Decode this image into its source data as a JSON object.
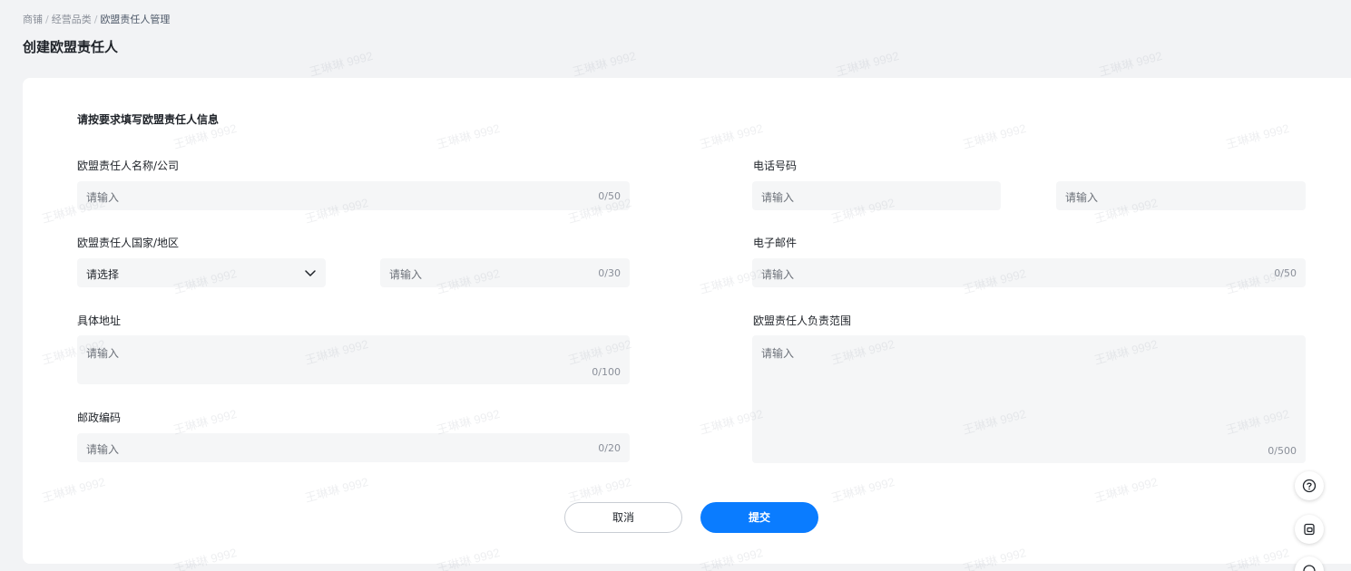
{
  "breadcrumb": {
    "items": [
      "商铺",
      "经营品类",
      "欧盟责任人管理"
    ],
    "separator": "/"
  },
  "page_title": "创建欧盟责任人",
  "form": {
    "section_title": "请按要求填写欧盟责任人信息",
    "name": {
      "label": "欧盟责任人名称/公司",
      "placeholder": "请输入",
      "count": "0/50"
    },
    "country": {
      "label": "欧盟责任人国家/地区",
      "select_value": "请选择",
      "region_placeholder": "请输入",
      "region_count": "0/30"
    },
    "address": {
      "label": "具体地址",
      "placeholder": "请输入",
      "count": "0/100"
    },
    "postcode": {
      "label": "邮政编码",
      "placeholder": "请输入",
      "count": "0/20"
    },
    "phone": {
      "label": "电话号码",
      "placeholder_code": "请输入",
      "placeholder_number": "请输入"
    },
    "email": {
      "label": "电子邮件",
      "placeholder": "请输入",
      "count": "0/50"
    },
    "scope": {
      "label": "欧盟责任人负责范围",
      "placeholder": "请输入",
      "count": "0/500"
    }
  },
  "actions": {
    "cancel_label": "取消",
    "submit_label": "提交"
  },
  "floating": {
    "icons": [
      "help-icon",
      "feedback-icon"
    ]
  },
  "watermark": "王琳琳 9992",
  "colors": {
    "primary": "#0a7cff",
    "input_bg": "#f5f6f7",
    "page_bg": "#f2f3f5"
  }
}
